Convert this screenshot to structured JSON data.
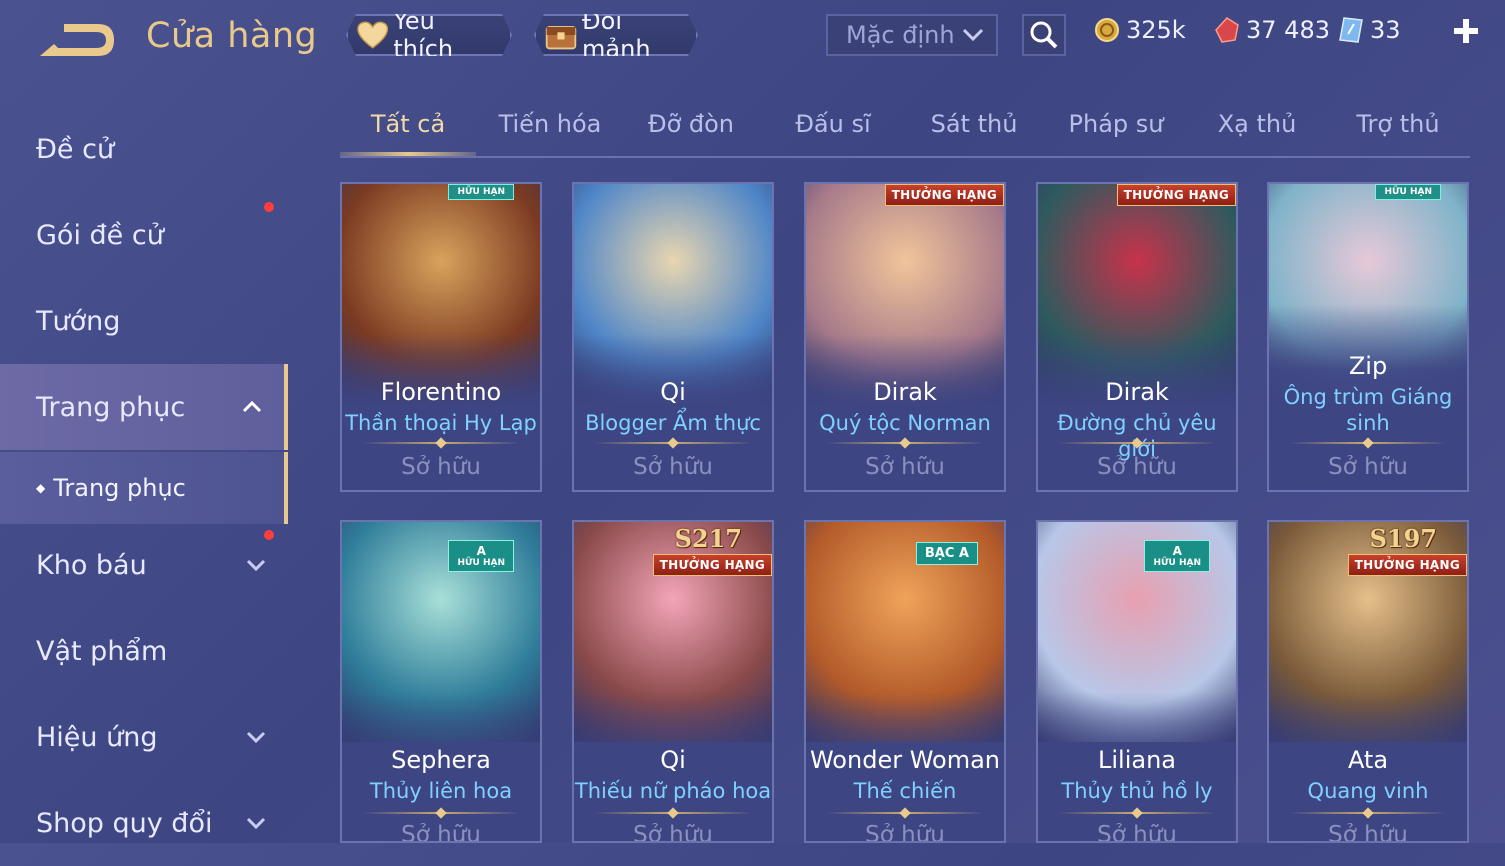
{
  "header": {
    "title": "Cửa hàng",
    "favorites_label": "Yêu thích",
    "exchange_label": "Đổi mảnh",
    "sort_label": "Mặc định",
    "currencies": [
      {
        "icon": "gold-coin-icon",
        "value": "325k"
      },
      {
        "icon": "red-gem-icon",
        "value": "37 483"
      },
      {
        "icon": "voucher-icon",
        "value": "33"
      }
    ]
  },
  "sidebar": {
    "items": [
      {
        "label": "Đề cử",
        "notify": false
      },
      {
        "label": "Gói đề cử",
        "notify": true
      },
      {
        "label": "Tướng",
        "notify": false
      },
      {
        "label": "Trang phục",
        "expanded": true,
        "active": true
      },
      {
        "label": "Trang phục",
        "sub": true
      },
      {
        "label": "Kho báu",
        "notify": true,
        "expandable": true
      },
      {
        "label": "Vật phẩm"
      },
      {
        "label": "Hiệu ứng",
        "expandable": true
      },
      {
        "label": "Shop quy đổi",
        "expandable": true
      }
    ]
  },
  "tabs": [
    "Tất cả",
    "Tiến hóa",
    "Đỡ đòn",
    "Đấu sĩ",
    "Sát thủ",
    "Pháp sư",
    "Xạ thủ",
    "Trợ thủ"
  ],
  "active_tab": 0,
  "cards": [
    {
      "hero": "Florentino",
      "skin": "Thần thoại Hy Lạp",
      "status": "Sở hữu",
      "badge": "HỮU HẠN",
      "colors": [
        "#7a3a22",
        "#d9a35c"
      ]
    },
    {
      "hero": "Qi",
      "skin": "Blogger Ẩm thực",
      "status": "Sở hữu",
      "badge": "",
      "colors": [
        "#4f86c8",
        "#e8d6b0"
      ]
    },
    {
      "hero": "Dirak",
      "skin": "Quý tộc Norman",
      "status": "Sở hữu",
      "badge": "THƯỞNG HẠNG",
      "colors": [
        "#a77a8a",
        "#f0c59a"
      ]
    },
    {
      "hero": "Dirak",
      "skin": "Đường chủ yêu giới",
      "status": "Sở hữu",
      "badge": "THƯỞNG HẠNG",
      "colors": [
        "#2e5a5e",
        "#c8324a"
      ]
    },
    {
      "hero": "Zip",
      "skin": "Ông trùm Giáng sinh",
      "status": "Sở hữu",
      "badge": "HỮU HẠN",
      "colors": [
        "#7fb3c9",
        "#e7c9d8"
      ]
    },
    {
      "hero": "Sephera",
      "skin": "Thủy liên hoa",
      "status": "Sở hữu",
      "badge": "HỮU HẠN",
      "tier": "A",
      "colors": [
        "#2f7d9a",
        "#a8e0d8"
      ]
    },
    {
      "hero": "Qi",
      "skin": "Thiếu nữ pháo hoa",
      "status": "Sở hữu",
      "badge": "THƯỞNG HẠNG",
      "season": "S217",
      "colors": [
        "#8a4a4a",
        "#f3a5b8"
      ]
    },
    {
      "hero": "Wonder Woman",
      "skin": "Thế chiến",
      "status": "Sở hữu",
      "badge": "BẠC A",
      "colors": [
        "#b35a2a",
        "#f0a45a"
      ]
    },
    {
      "hero": "Liliana",
      "skin": "Thủy thủ hồ ly",
      "status": "Sở hữu",
      "badge": "HỮU HẠN",
      "tier": "A",
      "colors": [
        "#b8c7e8",
        "#e8a0b0"
      ]
    },
    {
      "hero": "Ata",
      "skin": "Quang vinh",
      "status": "Sở hữu",
      "badge": "THƯỞNG HẠNG",
      "season": "S197",
      "colors": [
        "#7a5a3a",
        "#e6c08a"
      ]
    }
  ]
}
